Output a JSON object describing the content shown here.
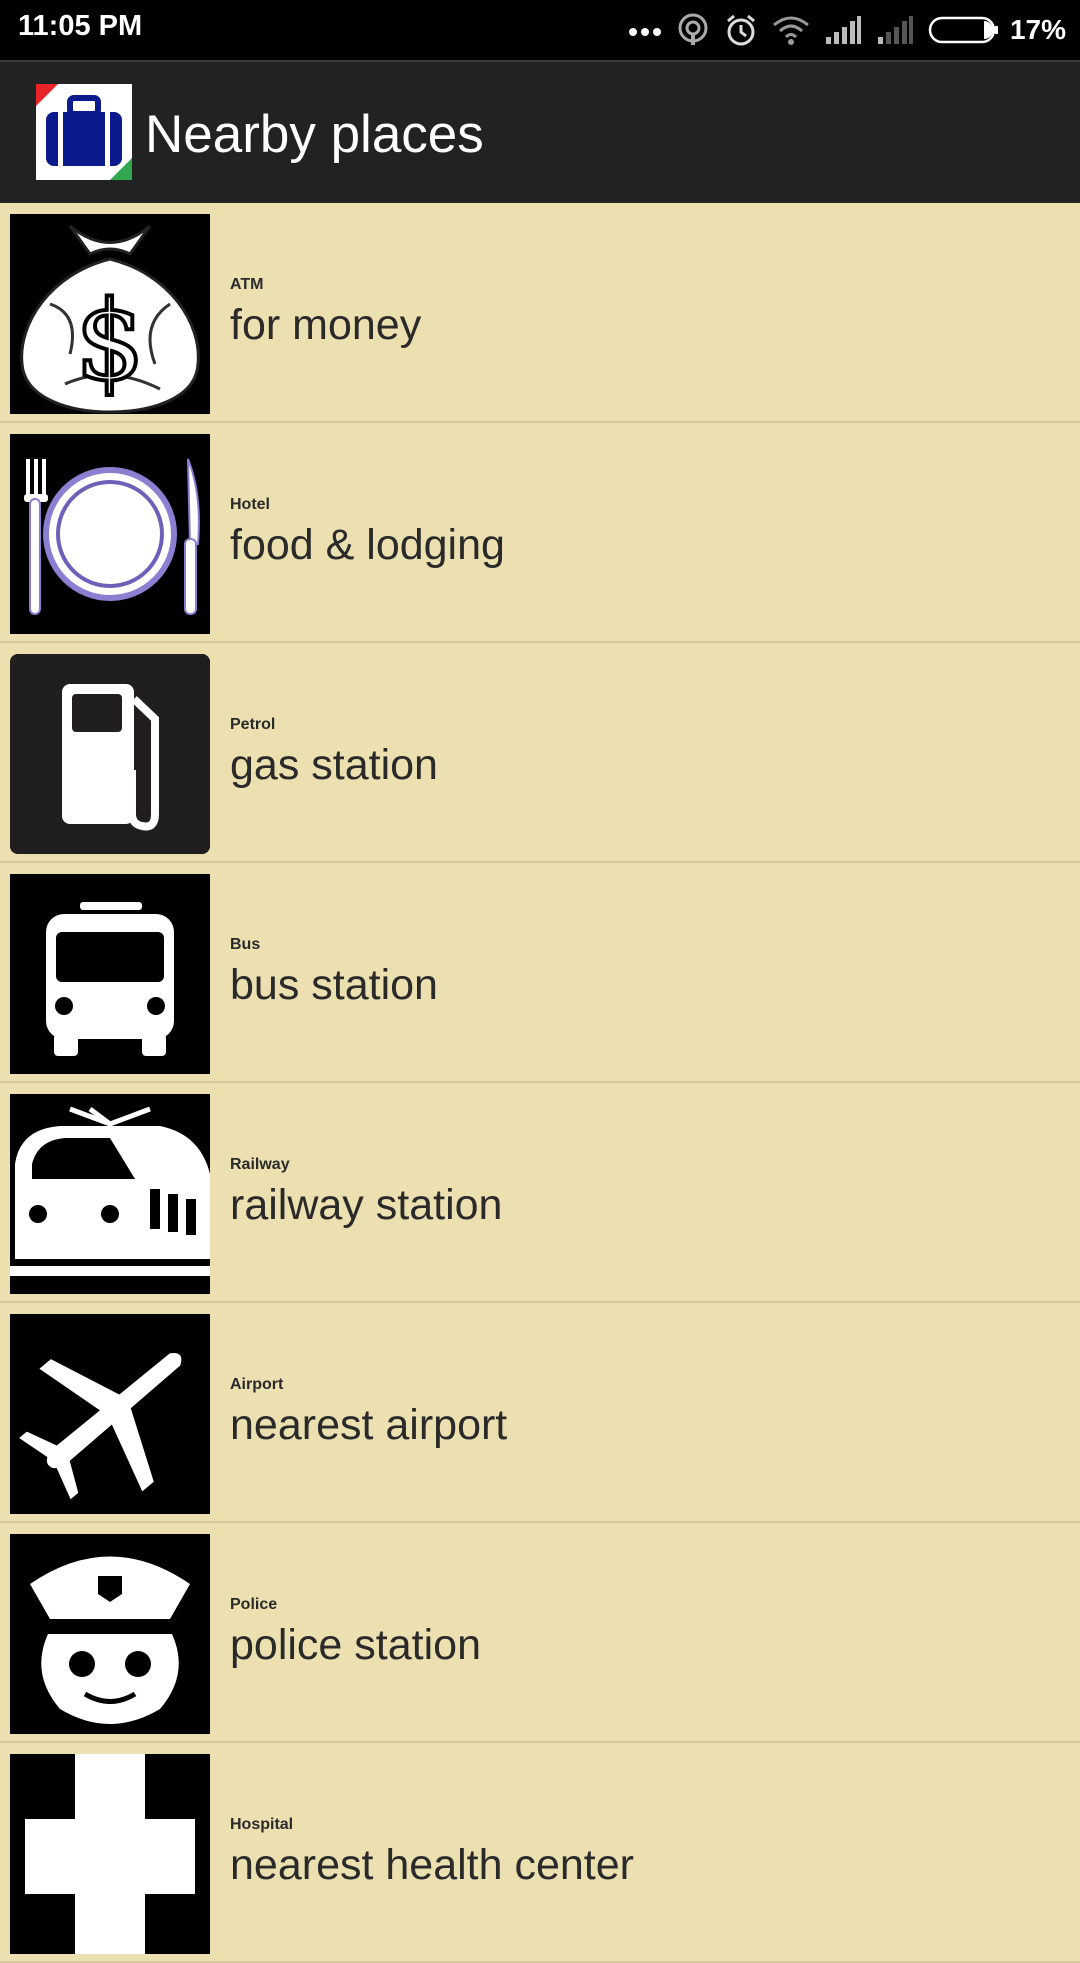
{
  "status_bar": {
    "time": "11:05 PM",
    "battery": "17%",
    "icons": [
      "more-dots-icon",
      "hotspot-icon",
      "alarm-icon",
      "wifi-icon",
      "signal-icon",
      "signal-weak-icon",
      "battery-icon"
    ]
  },
  "app_bar": {
    "title": "Nearby places",
    "logo_icon": "suitcase-icon"
  },
  "places": [
    {
      "category": "ATM",
      "title": "for money",
      "icon": "money-bag-icon"
    },
    {
      "category": "Hotel",
      "title": "food & lodging",
      "icon": "plate-cutlery-icon"
    },
    {
      "category": "Petrol",
      "title": "gas station",
      "icon": "fuel-pump-icon"
    },
    {
      "category": "Bus",
      "title": "bus station",
      "icon": "bus-icon"
    },
    {
      "category": "Railway",
      "title": "railway station",
      "icon": "train-icon"
    },
    {
      "category": "Airport",
      "title": "nearest airport",
      "icon": "airplane-icon"
    },
    {
      "category": "Police",
      "title": "police station",
      "icon": "police-icon"
    },
    {
      "category": "Hospital",
      "title": "nearest health center",
      "icon": "medical-cross-icon"
    }
  ],
  "colors": {
    "list_background": "#ede0b0",
    "app_bar": "#222222",
    "logo_blue": "#0b1a8c",
    "logo_red": "#e8242a",
    "logo_green": "#2fa84f"
  }
}
